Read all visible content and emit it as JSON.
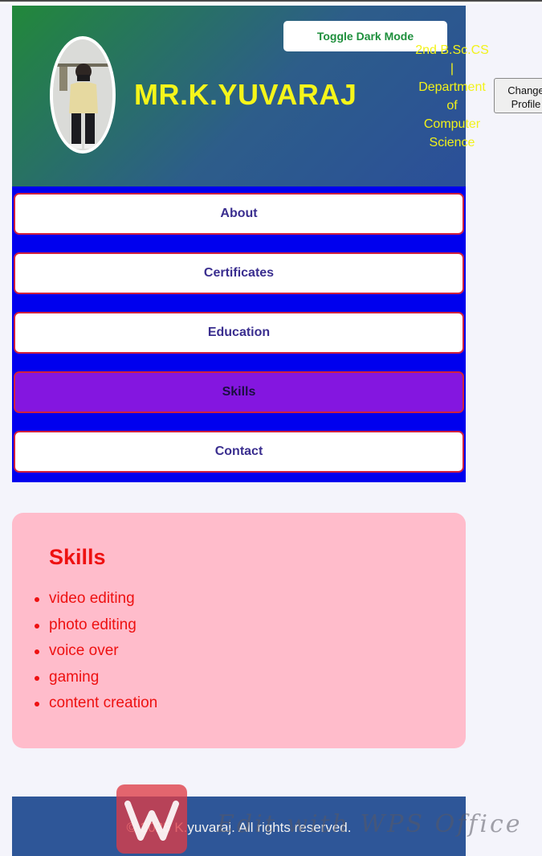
{
  "header": {
    "toggle_label": "Toggle Dark Mode",
    "name": "MR.K.YUVARAJ",
    "dept_lines": [
      "2nd B.Sc.CS",
      "|",
      "Department",
      "of",
      "Computer",
      "Science"
    ],
    "change_profile_label": "Change Profile"
  },
  "nav": {
    "items": [
      {
        "label": "About"
      },
      {
        "label": "Certificates"
      },
      {
        "label": "Education"
      },
      {
        "label": "Skills",
        "active": true
      },
      {
        "label": "Contact"
      }
    ]
  },
  "skills_section": {
    "title": "Skills",
    "items": [
      "video editing",
      "photo editing",
      "voice over",
      "gaming",
      "content creation"
    ]
  },
  "footer": {
    "text": "© 2025 K.yuvaraj. All rights reserved."
  },
  "watermark": {
    "text": "Edit with WPS Office"
  },
  "colors": {
    "name": "#f5f51a",
    "nav_background": "#0000ee",
    "active_nav": "#8416e0",
    "skills_card": "#ffbccb",
    "skills_text": "#ee1111",
    "footer": "#2e5698"
  }
}
